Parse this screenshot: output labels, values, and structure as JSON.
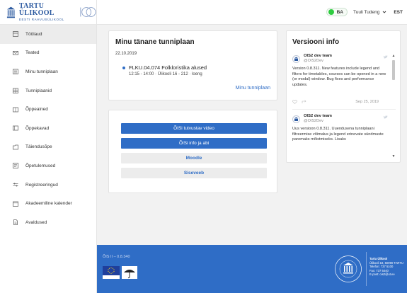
{
  "logo": {
    "name": "TARTU ÜLIKOOL",
    "tagline": "EESTI RAHVUSÜLIKOOL"
  },
  "topbar": {
    "language_toggle": "BA",
    "user_name": "Tuuli Tudeng",
    "language": "EST"
  },
  "sidebar": {
    "items": [
      {
        "label": "Töölaud",
        "icon": "dashboard-icon",
        "active": true
      },
      {
        "label": "Teated",
        "icon": "envelope-icon",
        "active": false
      },
      {
        "label": "Minu tunniplaan",
        "icon": "calendar-icon",
        "active": false
      },
      {
        "label": "Tunniplaanid",
        "icon": "calendar-grid-icon",
        "active": false
      },
      {
        "label": "Õppeained",
        "icon": "book-icon",
        "active": false
      },
      {
        "label": "Õppekavad",
        "icon": "books-icon",
        "active": false
      },
      {
        "label": "Täiendusõpe",
        "icon": "folder-icon",
        "active": false
      },
      {
        "label": "Õpetulemused",
        "icon": "certificate-icon",
        "active": false
      },
      {
        "label": "Registreeringud",
        "icon": "sliders-icon",
        "active": false
      },
      {
        "label": "Akadeemiline kalender",
        "icon": "calendar-list-icon",
        "active": false
      },
      {
        "label": "Avaldused",
        "icon": "document-icon",
        "active": false
      }
    ]
  },
  "schedule": {
    "title": "Minu tänane tunniplaan",
    "date": "22.10.2019",
    "lesson": {
      "title": "FLKU.04.074 Folkloristika alused",
      "meta": "12:15 - 14:00 · Ülikooli 16 - 212 · loeng"
    },
    "link": "Minu tunniplaan"
  },
  "links": {
    "buttons": [
      {
        "label": "ÕISi tutvustav video",
        "style": "primary"
      },
      {
        "label": "ÕISi info ja abi",
        "style": "primary"
      },
      {
        "label": "Moodle",
        "style": "secondary"
      },
      {
        "label": "Siseveeb",
        "style": "secondary"
      }
    ]
  },
  "version_info": {
    "title": "Versiooni info",
    "tweets": [
      {
        "name": "OIS2 dev team",
        "handle": "@OIS2Dev",
        "text": "Version 0.8.311. New features include legend and filters for timetables, courses can be opened in a new (or modal) window. Bug fixes and performance updates.",
        "date": "Sep 25, 2019"
      },
      {
        "name": "OIS2 dev team",
        "handle": "@OIS2Dev",
        "text": "Uus versioon 0.8.311. Uuendusena tunniplaani filtreermise võimalus ja legend erinevate sündmuste paremaks mõistmiseks. Lisaks"
      }
    ]
  },
  "footer": {
    "version": "ÕIS II – 0.8.340",
    "contacts": {
      "org": "Tartu Ülikool",
      "address": "Ülikooli 18, 50090 TARTU",
      "phone": "Telefon: 737 5100",
      "fax": "Fax: 737 5440",
      "email": "E-post: ois2@ut.ee"
    }
  },
  "colors": {
    "accent": "#2f6dc6",
    "toggle": "#2ecc40",
    "background": "#f2f2f2"
  }
}
